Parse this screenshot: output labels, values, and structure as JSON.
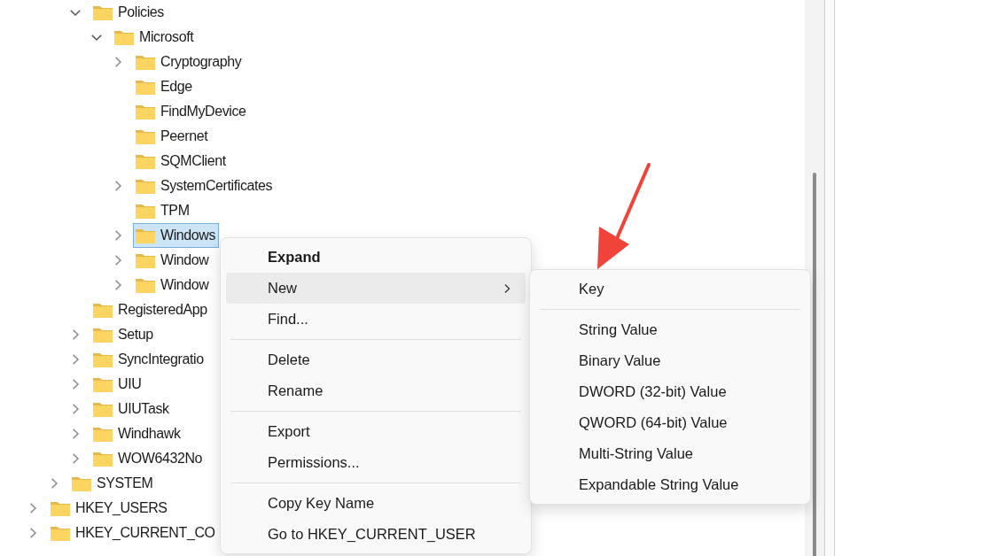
{
  "tree": [
    {
      "children": [
        {
          "children": [
            {
              "children": [
                {
                  "name": "Policies",
                  "expandable": true,
                  "expanded": true,
                  "selected": false,
                  "children": [
                    {
                      "name": "Microsoft",
                      "expandable": true,
                      "expanded": true,
                      "selected": false,
                      "children": [
                        {
                          "name": "Cryptography",
                          "expandable": true,
                          "expanded": false,
                          "selected": false
                        },
                        {
                          "name": "Edge",
                          "selected": false
                        },
                        {
                          "name": "FindMyDevice",
                          "selected": false
                        },
                        {
                          "name": "Peernet",
                          "selected": false
                        },
                        {
                          "name": "SQMClient",
                          "selected": false
                        },
                        {
                          "name": "SystemCertificates",
                          "expandable": true,
                          "expanded": false,
                          "selected": false
                        },
                        {
                          "name": "TPM",
                          "selected": false
                        },
                        {
                          "name": "Windows",
                          "expandable": true,
                          "expanded": false,
                          "selected": true
                        },
                        {
                          "name": "Window",
                          "expandable": true,
                          "expanded": false,
                          "selected": false
                        },
                        {
                          "name": "Window",
                          "expandable": true,
                          "expanded": false,
                          "selected": false
                        }
                      ]
                    }
                  ]
                },
                {
                  "name": "RegisteredApp",
                  "selected": false
                },
                {
                  "name": "Setup",
                  "expandable": true,
                  "expanded": false,
                  "selected": false
                },
                {
                  "name": "SyncIntegratio",
                  "expandable": true,
                  "expanded": false,
                  "selected": false
                },
                {
                  "name": "UIU",
                  "expandable": true,
                  "expanded": false,
                  "selected": false
                },
                {
                  "name": "UIUTask",
                  "expandable": true,
                  "expanded": false,
                  "selected": false
                },
                {
                  "name": "Windhawk",
                  "expandable": true,
                  "expanded": false,
                  "selected": false
                },
                {
                  "name": "WOW6432No",
                  "expandable": true,
                  "expanded": false,
                  "selected": false
                }
              ]
            },
            {
              "name": "SYSTEM",
              "expandable": true,
              "expanded": false,
              "selected": false
            }
          ]
        },
        {
          "name": "HKEY_USERS",
          "expandable": true,
          "expanded": false,
          "selected": false
        },
        {
          "name": "HKEY_CURRENT_CO",
          "expandable": true,
          "expanded": false,
          "selected": false
        }
      ]
    }
  ],
  "context_menu": [
    {
      "kind": "item",
      "label": "Expand",
      "bold": true,
      "selected": false,
      "submenu": false
    },
    {
      "kind": "item",
      "label": "New",
      "bold": false,
      "selected": true,
      "submenu": true
    },
    {
      "kind": "item",
      "label": "Find...",
      "bold": false,
      "selected": false,
      "submenu": false
    },
    {
      "kind": "separator"
    },
    {
      "kind": "item",
      "label": "Delete",
      "bold": false,
      "selected": false,
      "submenu": false
    },
    {
      "kind": "item",
      "label": "Rename",
      "bold": false,
      "selected": false,
      "submenu": false
    },
    {
      "kind": "separator"
    },
    {
      "kind": "item",
      "label": "Export",
      "bold": false,
      "selected": false,
      "submenu": false
    },
    {
      "kind": "item",
      "label": "Permissions...",
      "bold": false,
      "selected": false,
      "submenu": false
    },
    {
      "kind": "separator"
    },
    {
      "kind": "item",
      "label": "Copy Key Name",
      "bold": false,
      "selected": false,
      "submenu": false
    },
    {
      "kind": "item",
      "label": "Go to HKEY_CURRENT_USER",
      "bold": false,
      "selected": false,
      "submenu": false
    }
  ],
  "submenu": [
    {
      "kind": "item",
      "label": "Key"
    },
    {
      "kind": "separator"
    },
    {
      "kind": "item",
      "label": "String Value"
    },
    {
      "kind": "item",
      "label": "Binary Value"
    },
    {
      "kind": "item",
      "label": "DWORD (32-bit) Value"
    },
    {
      "kind": "item",
      "label": "QWORD (64-bit) Value"
    },
    {
      "kind": "item",
      "label": "Multi-String Value"
    },
    {
      "kind": "item",
      "label": "Expandable String Value"
    }
  ]
}
